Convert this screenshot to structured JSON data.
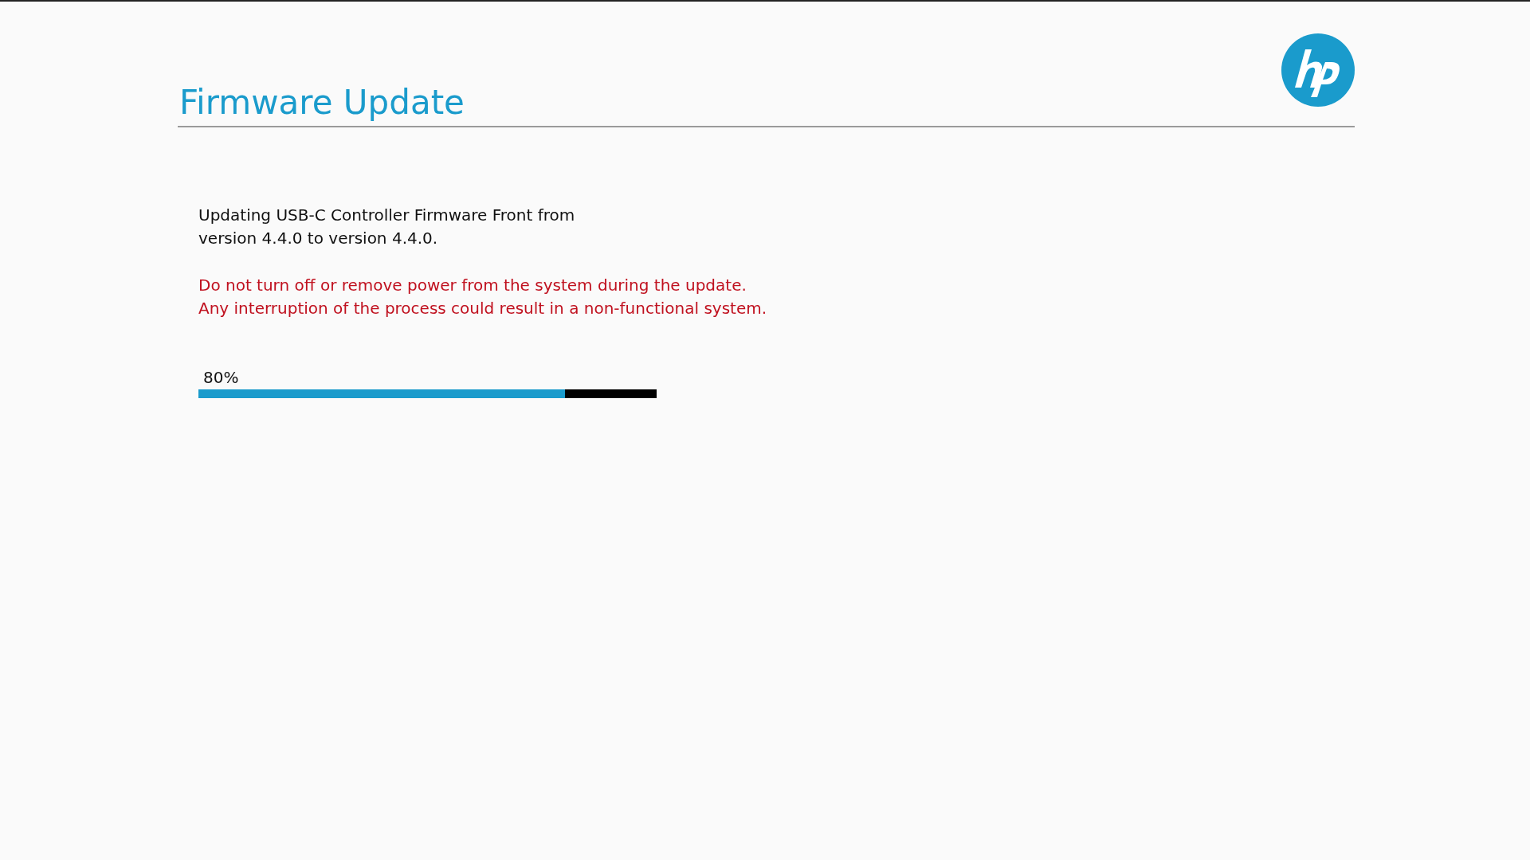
{
  "header": {
    "title": "Firmware Update"
  },
  "message": {
    "lines": [
      "Updating USB-C Controller Firmware Front from",
      "version 4.4.0 to version 4.4.0."
    ]
  },
  "warning": {
    "lines": [
      "Do not turn off or remove power from the system during the update.",
      "Any interruption of the process could result in a non-functional system."
    ]
  },
  "progress": {
    "label": "80%",
    "level": 0.8
  }
}
